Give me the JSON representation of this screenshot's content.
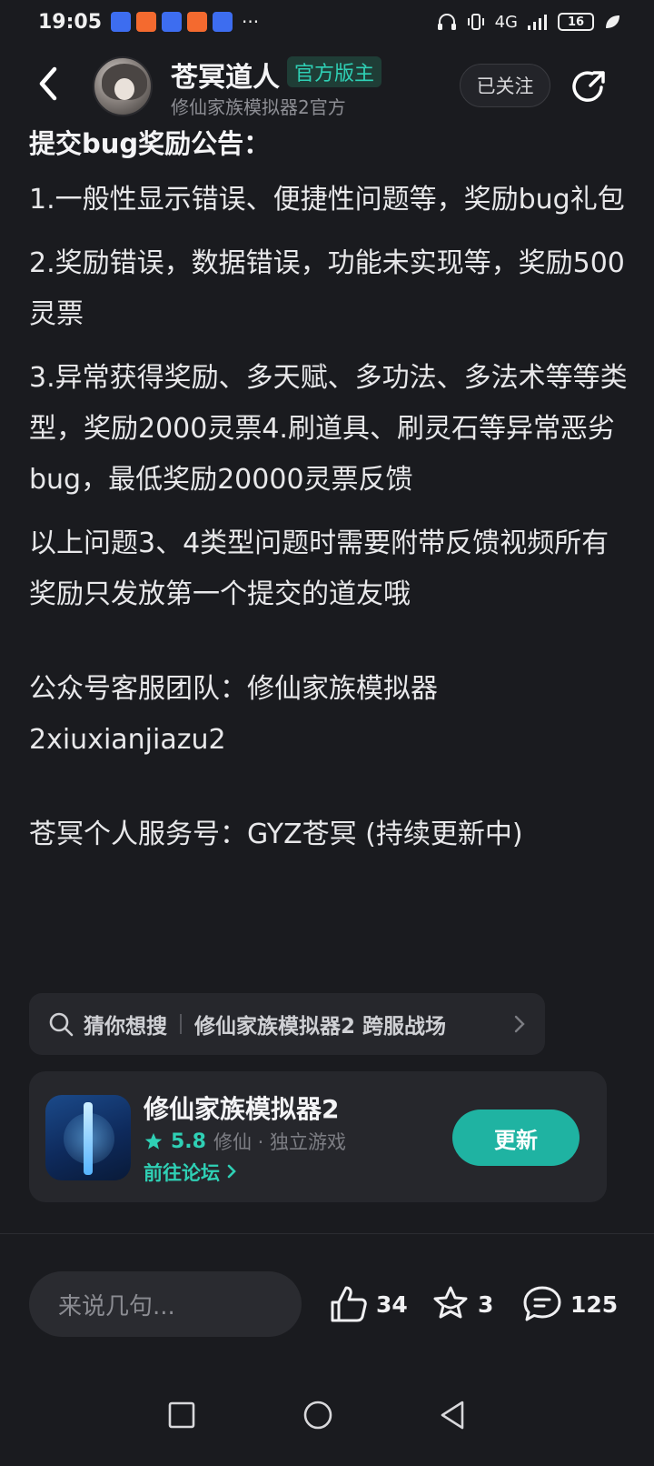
{
  "status_bar": {
    "time": "19:05",
    "more": "···",
    "network": "4G",
    "battery": "16"
  },
  "header": {
    "author_name": "苍冥道人",
    "author_badge": "官方版主",
    "author_subtitle": "修仙家族模拟器2官方",
    "follow_label": "已关注"
  },
  "post": {
    "title": "提交bug奖励公告：",
    "paragraphs": [
      "1.一般性显示错误、便捷性问题等，奖励bug礼包",
      "2.奖励错误，数据错误，功能未实现等，奖励500灵票",
      "3.异常获得奖励、多天赋、多功法、多法术等等类型，奖励2000灵票4.刷道具、刷灵石等异常恶劣bug，最低奖励20000灵票反馈",
      "以上问题3、4类型问题时需要附带反馈视频所有奖励只发放第一个提交的道友哦",
      "公众号客服团队：修仙家族模拟器2xiuxianjiazu2",
      "苍冥个人服务号：GYZ苍冥 (持续更新中)"
    ]
  },
  "suggestion": {
    "label": "猜你想搜",
    "query": "修仙家族模拟器2 跨服战场"
  },
  "game_card": {
    "name": "修仙家族模拟器2",
    "rating": "5.8",
    "tags": "修仙 · 独立游戏",
    "forum_link": "前往论坛",
    "update_label": "更新"
  },
  "bottom_bar": {
    "comment_placeholder": "来说几句...",
    "likes": "34",
    "favorites": "3",
    "comments": "125"
  },
  "colors": {
    "background": "#1a1b1f",
    "accent": "#1fb3a2",
    "badge_text": "#2fd0b5"
  }
}
